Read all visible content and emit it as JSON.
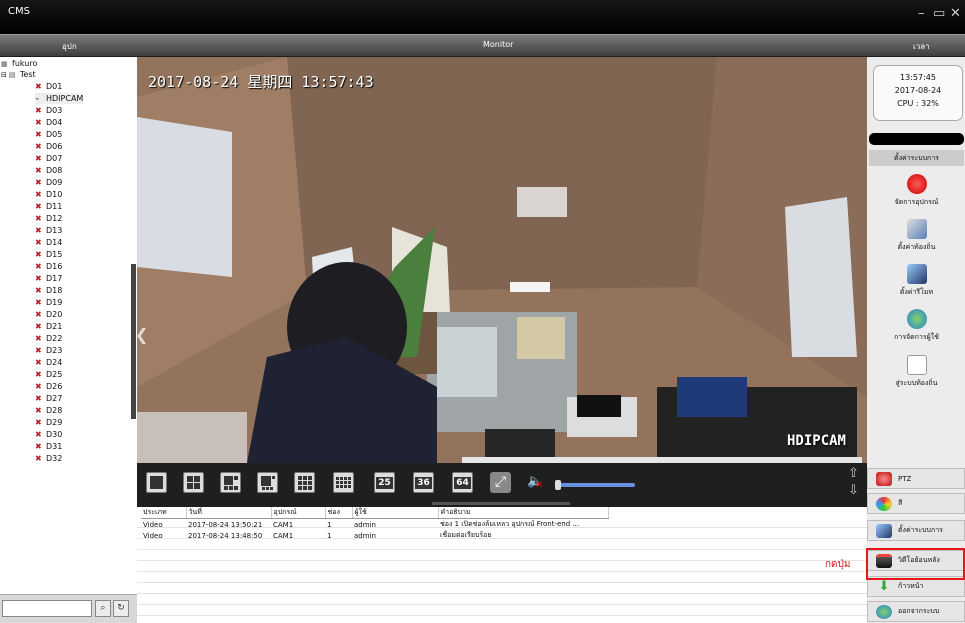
{
  "window": {
    "title": "CMS",
    "controls": [
      "minimize-icon",
      "maximize-icon",
      "close-icon"
    ]
  },
  "menubar": {
    "left": "อุปก",
    "center": "Monitor",
    "right": "เวลา"
  },
  "tree": {
    "root": "fukuro",
    "group": "Test",
    "devices": [
      "D01",
      "HDIPCAM",
      "D03",
      "D04",
      "D05",
      "D06",
      "D07",
      "D08",
      "D09",
      "D10",
      "D11",
      "D12",
      "D13",
      "D14",
      "D15",
      "D16",
      "D17",
      "D18",
      "D19",
      "D20",
      "D21",
      "D22",
      "D23",
      "D24",
      "D25",
      "D26",
      "D27",
      "D28",
      "D29",
      "D30",
      "D31",
      "D32"
    ],
    "selected": "HDIPCAM"
  },
  "video": {
    "timestamp": "2017-08-24 星期四 13:57:43",
    "camera_label": "HDIPCAM"
  },
  "layouts": [
    "1",
    "4",
    "6",
    "8",
    "9",
    "16",
    "25",
    "36",
    "64"
  ],
  "log": {
    "headers": [
      "ประเภท",
      "วันที่",
      "อุปกรณ์",
      "ช่อง",
      "ผู้ใช้",
      "คำอธิบาย"
    ],
    "rows": [
      [
        "Video",
        "2017-08-24 13:50:21",
        "CAM1",
        "1",
        "admin",
        "ช่อง 1 เปิดช่องล้มเหลว อุปกรณ์ Front-end ..."
      ],
      [
        "Video",
        "2017-08-24 13:48:50",
        "CAM1",
        "1",
        "admin",
        "เชื่อมต่อเรียบร้อย"
      ]
    ]
  },
  "annotation": "กดปุ่ม",
  "clock": {
    "time": "13:57:45",
    "date": "2017-08-24",
    "cpu": "CPU : 32%"
  },
  "system": {
    "header": "ตั้งค่าระบบการ",
    "items": [
      "จัดการอุปกรณ์",
      "ตั้งค่าท้องถิ่น",
      "ตั้งค่ารีโมท",
      "การจัดการผู้ใช้",
      "สู่ระบบท้องถิ่น"
    ]
  },
  "buttons": [
    "PTZ",
    "สี",
    "ตั้งค่าระบบการ",
    "วิดีโอย้อนหลัง",
    "ก้าวหน้า",
    "ออกจากระบบ"
  ],
  "colors": {
    "highlight": "#e31818",
    "tree_offline": "#c41d1d",
    "volume": "#6a90e0"
  }
}
